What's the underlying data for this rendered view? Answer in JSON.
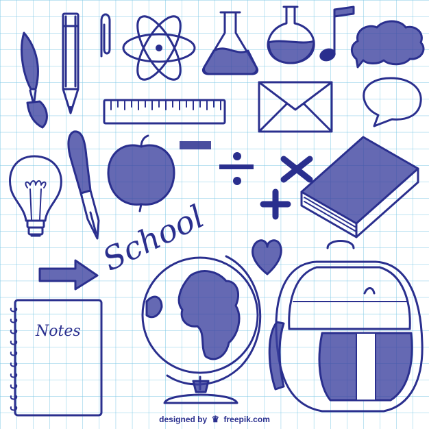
{
  "doodles": {
    "school_word": "School",
    "notes_word": "Notes"
  },
  "credit": {
    "prefix": "designed by",
    "logo_icon": "freepik-crown-icon",
    "site": "freepik.com"
  },
  "colors": {
    "ink": "#2a2f8e",
    "grid": "#7fc8e6",
    "paper": "#ffffff"
  }
}
